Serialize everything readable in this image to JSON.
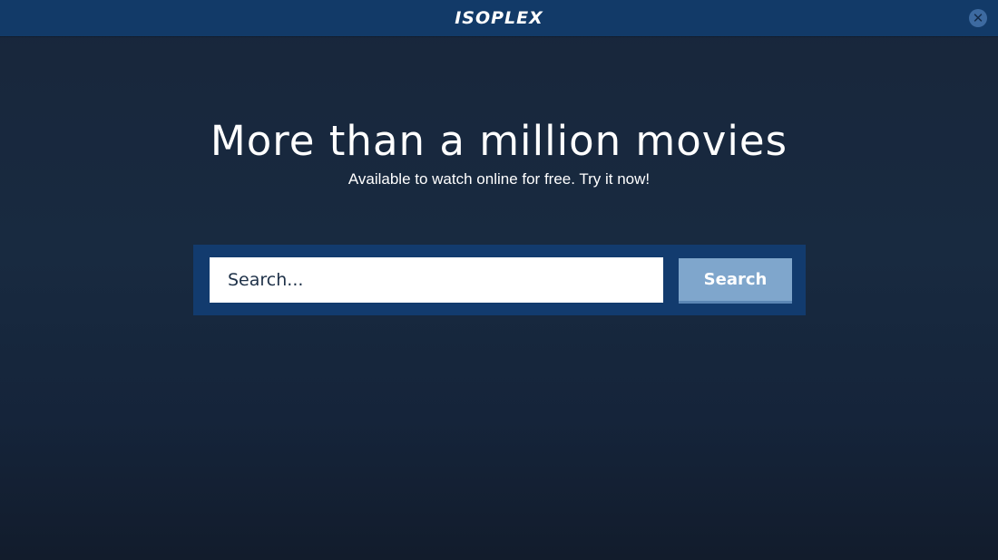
{
  "header": {
    "logo_text": "ISOPLEX",
    "close_label": "✕"
  },
  "hero": {
    "title": "More than a million movies",
    "subtitle": "Available to watch online for free. Try it now!"
  },
  "search": {
    "placeholder": "Search...",
    "value": "",
    "button_label": "Search"
  },
  "colors": {
    "background": "#182a40",
    "topbar": "#123a68",
    "search_panel": "#123b6e",
    "search_button": "#7fa6cc",
    "close_button": "#3d6aa0"
  }
}
